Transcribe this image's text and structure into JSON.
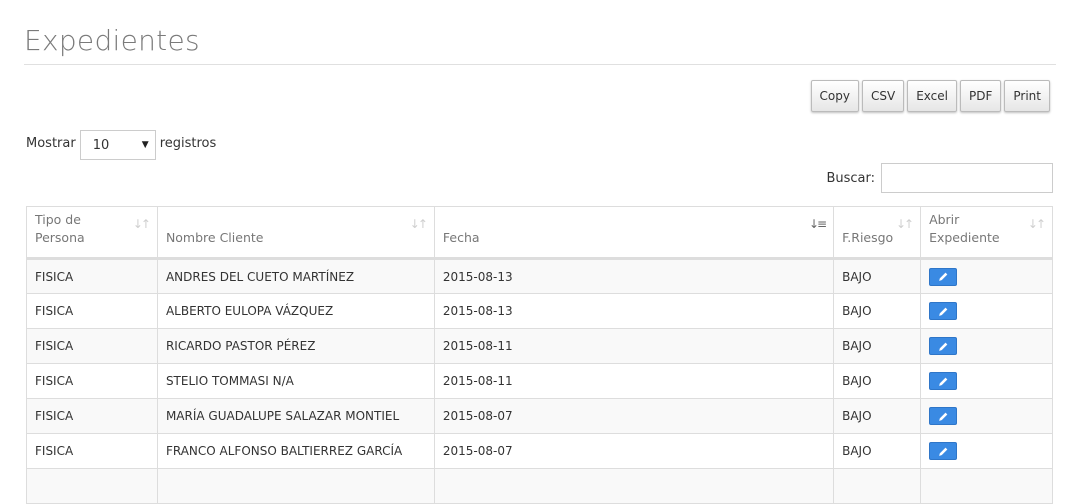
{
  "page": {
    "title": "Expedientes"
  },
  "export_buttons": [
    "Copy",
    "CSV",
    "Excel",
    "PDF",
    "Print"
  ],
  "length": {
    "label_before": "Mostrar",
    "selected": "10",
    "label_after": "registros"
  },
  "search": {
    "label": "Buscar:",
    "value": ""
  },
  "table": {
    "columns": [
      {
        "label": "Tipo de Persona",
        "sort": "both"
      },
      {
        "label": "Nombre Cliente",
        "sort": "both"
      },
      {
        "label": "Fecha",
        "sort": "desc"
      },
      {
        "label": "F.Riesgo",
        "sort": "both"
      },
      {
        "label": "Abrir Expediente",
        "sort": "both"
      }
    ],
    "rows": [
      {
        "tipo": "FISICA",
        "nombre": "ANDRES DEL CUETO MARTÍNEZ",
        "fecha": "2015-08-13",
        "riesgo": "BAJO"
      },
      {
        "tipo": "FISICA",
        "nombre": "ALBERTO EULOPA VÁZQUEZ",
        "fecha": "2015-08-13",
        "riesgo": "BAJO"
      },
      {
        "tipo": "FISICA",
        "nombre": "RICARDO PASTOR PÉREZ",
        "fecha": "2015-08-11",
        "riesgo": "BAJO"
      },
      {
        "tipo": "FISICA",
        "nombre": "STELIO TOMMASI N/A",
        "fecha": "2015-08-11",
        "riesgo": "BAJO"
      },
      {
        "tipo": "FISICA",
        "nombre": "MARÍA GUADALUPE SALAZAR MONTIEL",
        "fecha": "2015-08-07",
        "riesgo": "BAJO"
      },
      {
        "tipo": "FISICA",
        "nombre": "FRANCO ALFONSO BALTIERREZ GARCÍA",
        "fecha": "2015-08-07",
        "riesgo": "BAJO"
      },
      {
        "tipo": "",
        "nombre": "",
        "fecha": "",
        "riesgo": ""
      }
    ]
  },
  "icons": {
    "edit": "pencil-icon",
    "sort_both": "sort-both-icon",
    "sort_desc": "sort-desc-icon",
    "caret": "caret-down-icon"
  },
  "colors": {
    "edit_button": "#3a8ae3",
    "title": "#7a7a7a"
  }
}
